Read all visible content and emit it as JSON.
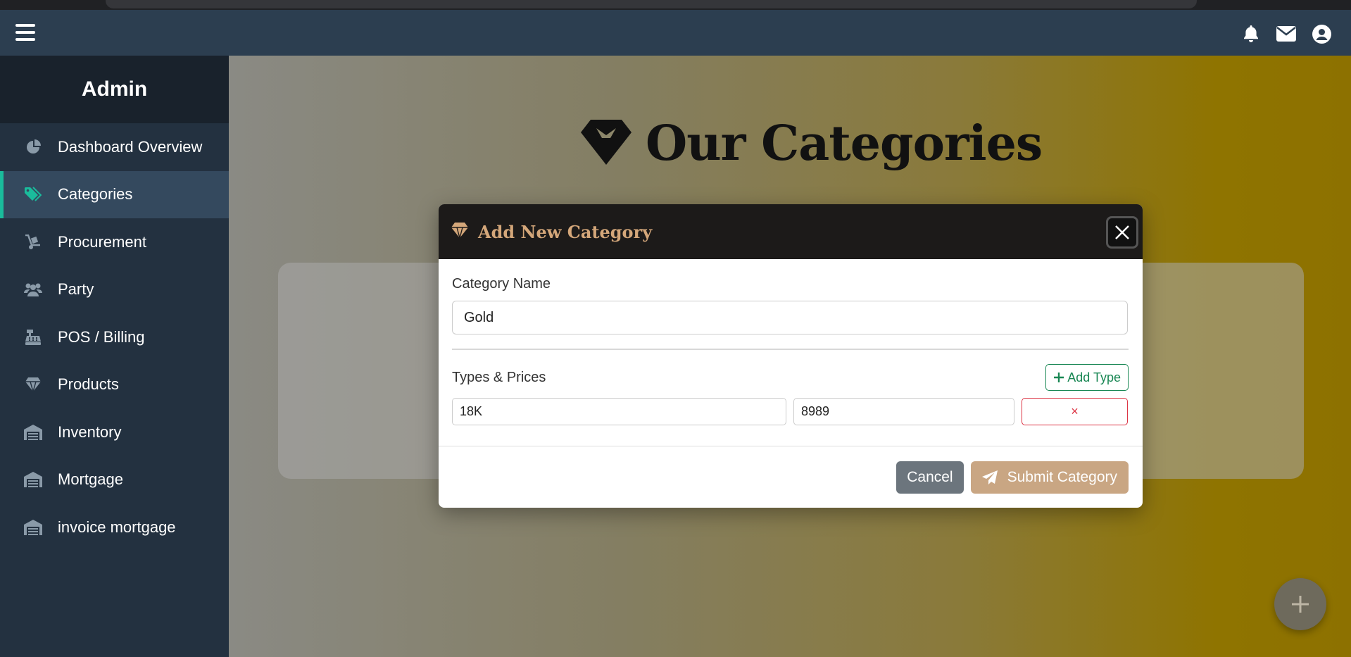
{
  "topbar": {
    "menu_icon": "hamburger-icon",
    "icons": [
      "bell-icon",
      "envelope-icon",
      "user-circle-icon"
    ]
  },
  "sidebar": {
    "brand": "Admin",
    "items": [
      {
        "label": "Dashboard Overview",
        "icon": "chart-pie-icon"
      },
      {
        "label": "Categories",
        "icon": "tags-icon",
        "active": true
      },
      {
        "label": "Procurement",
        "icon": "dolly-icon"
      },
      {
        "label": "Party",
        "icon": "users-icon"
      },
      {
        "label": "POS / Billing",
        "icon": "cash-register-icon"
      },
      {
        "label": "Products",
        "icon": "gem-icon"
      },
      {
        "label": "Inventory",
        "icon": "warehouse-icon"
      },
      {
        "label": "Mortgage",
        "icon": "warehouse-icon"
      },
      {
        "label": "invoice mortgage",
        "icon": "warehouse-icon"
      }
    ]
  },
  "main": {
    "title": "Our Categories",
    "title_icon": "gem-icon"
  },
  "modal": {
    "title": "Add New Category",
    "title_icon": "gem-icon",
    "category_name_label": "Category Name",
    "category_name_value": "Gold",
    "types_label": "Types & Prices",
    "add_type_label": "Add Type",
    "types": [
      {
        "type": "18K",
        "price": "8989",
        "remove": "×"
      }
    ],
    "cancel_label": "Cancel",
    "submit_label": "Submit Category"
  },
  "colors": {
    "topbar": "#2c3e50",
    "sidebar": "#233140",
    "accent": "#1abc9c",
    "modal_header": "#1c1a19",
    "gold_text": "#d4a77a",
    "submit": "#c9a683",
    "add_type": "#198754",
    "remove": "#dc3545"
  }
}
